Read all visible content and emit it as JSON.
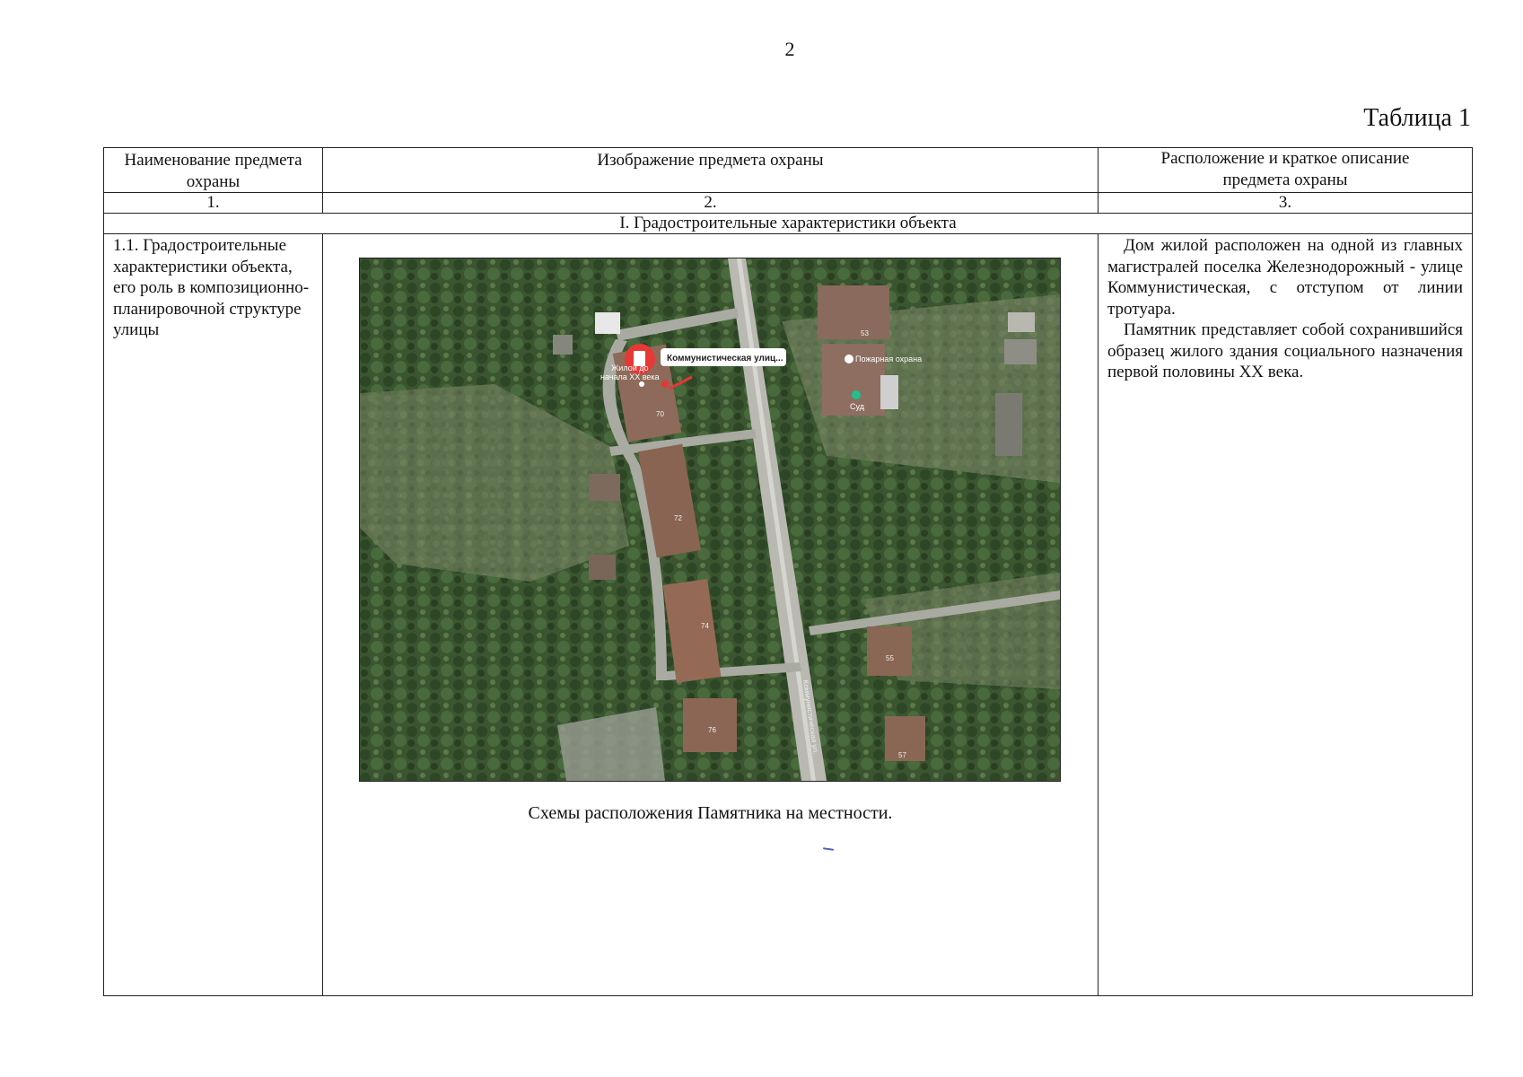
{
  "page_number": "2",
  "table_caption": "Таблица 1",
  "headers": [
    "Наименование предмета охраны",
    "Изображение предмета охраны",
    "Расположение и краткое описание предмета охраны"
  ],
  "column_numbers": [
    "1.",
    "2.",
    "3."
  ],
  "section_title": "I. Градостроительные характеристики объекта",
  "row": {
    "name": "1.1. Градостроительные характеристики объекта, его роль в композиционно-планировочной структуре улицы",
    "description_paragraphs": [
      "Дом жилой расположен на одной из главных магистралей поселка Железнодорожный - улице Коммунистическая, с отступом от линии тротуара.",
      "Памятник представляет собой сохранившийся образец жилого здания социального назначения первой половины XX века."
    ],
    "image_caption": "Схемы расположения Памятника на местности."
  },
  "map": {
    "marker_label": "Коммунистическая улиц...",
    "marker_sub_label_1": "Жилой до",
    "marker_sub_label_2": "начала XX века",
    "fire_station_label": "Пожарная охрана",
    "court_label": "Суд",
    "house_numbers": [
      "70",
      "72",
      "74",
      "76",
      "53",
      "55",
      "57"
    ],
    "street_label": "Коммунистическая ул."
  }
}
